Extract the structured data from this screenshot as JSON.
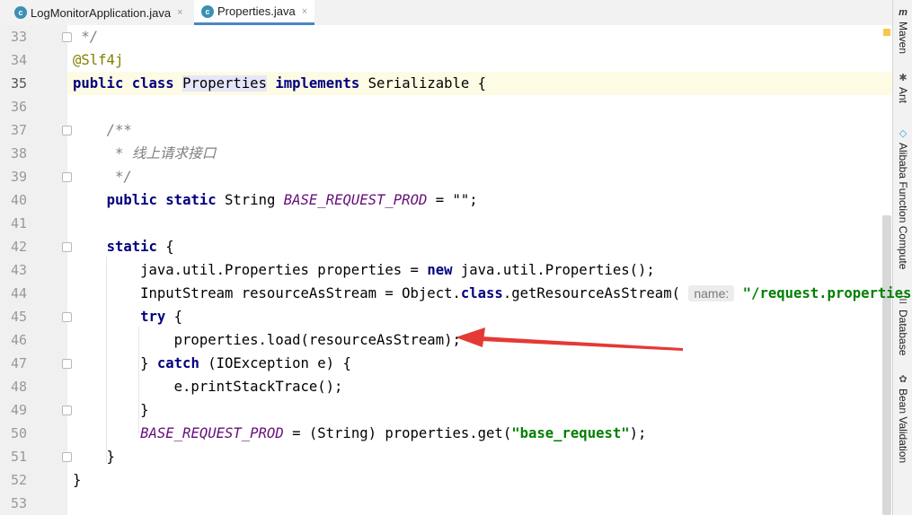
{
  "tabs": [
    {
      "label": "LogMonitorApplication.java",
      "icon_letter": "c",
      "close": "×"
    },
    {
      "label": "Properties.java",
      "icon_letter": "c",
      "close": "×"
    }
  ],
  "lines": [
    {
      "num": "33",
      "tokens": [
        {
          "t": " */",
          "c": "cmt"
        }
      ]
    },
    {
      "num": "34",
      "tokens": [
        {
          "t": "@Slf4j",
          "c": "ann"
        }
      ]
    },
    {
      "num": "35",
      "current": true,
      "tokens": [
        {
          "t": "public",
          "c": "kw"
        },
        {
          "t": " "
        },
        {
          "t": "class",
          "c": "kw"
        },
        {
          "t": " "
        },
        {
          "t": "Properties",
          "c": "selword"
        },
        {
          "t": " "
        },
        {
          "t": "implements",
          "c": "kw"
        },
        {
          "t": " Serializable {"
        }
      ]
    },
    {
      "num": "36",
      "tokens": []
    },
    {
      "num": "37",
      "tokens": [
        {
          "t": "    "
        },
        {
          "t": "/**",
          "c": "cmt"
        }
      ]
    },
    {
      "num": "38",
      "tokens": [
        {
          "t": "    "
        },
        {
          "t": " * 线上请求接口",
          "c": "cmt"
        }
      ]
    },
    {
      "num": "39",
      "tokens": [
        {
          "t": "    "
        },
        {
          "t": " */",
          "c": "cmt"
        }
      ]
    },
    {
      "num": "40",
      "tokens": [
        {
          "t": "    "
        },
        {
          "t": "public",
          "c": "kw"
        },
        {
          "t": " "
        },
        {
          "t": "static",
          "c": "kw"
        },
        {
          "t": " String "
        },
        {
          "t": "BASE_REQUEST_PROD",
          "c": "field"
        },
        {
          "t": " = \"\";"
        }
      ]
    },
    {
      "num": "41",
      "tokens": []
    },
    {
      "num": "42",
      "tokens": [
        {
          "t": "    "
        },
        {
          "t": "static",
          "c": "kw"
        },
        {
          "t": " {"
        }
      ]
    },
    {
      "num": "43",
      "tokens": [
        {
          "t": "        java.util.Properties properties = "
        },
        {
          "t": "new",
          "c": "kw"
        },
        {
          "t": " java.util.Properties();"
        }
      ]
    },
    {
      "num": "44",
      "tokens": [
        {
          "t": "        InputStream resourceAsStream = Object."
        },
        {
          "t": "class",
          "c": "kw"
        },
        {
          "t": ".getResourceAsStream( "
        },
        {
          "t": "name:",
          "c": "hint"
        },
        {
          "t": " "
        },
        {
          "t": "\"/request.properties\"",
          "c": "str"
        },
        {
          "t": ");"
        }
      ]
    },
    {
      "num": "45",
      "tokens": [
        {
          "t": "        "
        },
        {
          "t": "try",
          "c": "kw"
        },
        {
          "t": " {"
        }
      ]
    },
    {
      "num": "46",
      "tokens": [
        {
          "t": "            properties.load(resourceAsStream);"
        }
      ]
    },
    {
      "num": "47",
      "tokens": [
        {
          "t": "        } "
        },
        {
          "t": "catch",
          "c": "kw"
        },
        {
          "t": " (IOException e) {"
        }
      ]
    },
    {
      "num": "48",
      "tokens": [
        {
          "t": "            e.printStackTrace();"
        }
      ]
    },
    {
      "num": "49",
      "tokens": [
        {
          "t": "        }"
        }
      ]
    },
    {
      "num": "50",
      "tokens": [
        {
          "t": "        "
        },
        {
          "t": "BASE_REQUEST_PROD",
          "c": "field"
        },
        {
          "t": " = (String) properties.get("
        },
        {
          "t": "\"base_request\"",
          "c": "str"
        },
        {
          "t": ");"
        }
      ]
    },
    {
      "num": "51",
      "tokens": [
        {
          "t": "    }"
        }
      ]
    },
    {
      "num": "52",
      "tokens": [
        {
          "t": "}"
        }
      ]
    },
    {
      "num": "53",
      "tokens": []
    }
  ],
  "tool_windows": [
    {
      "label": "Maven",
      "icon": "m"
    },
    {
      "label": "Ant",
      "icon": "ant-icon"
    },
    {
      "label": "Alibaba Function Compute",
      "icon": "alibaba-icon"
    },
    {
      "label": "Database",
      "icon": "database-icon"
    },
    {
      "label": "Bean Validation",
      "icon": "bean-validation-icon"
    }
  ],
  "colors": {
    "keyword": "#000080",
    "comment": "#808080",
    "string": "#008000",
    "field": "#660e7a",
    "annotation": "#808000",
    "arrow": "#e53935",
    "current_line": "#fdfbe3"
  }
}
